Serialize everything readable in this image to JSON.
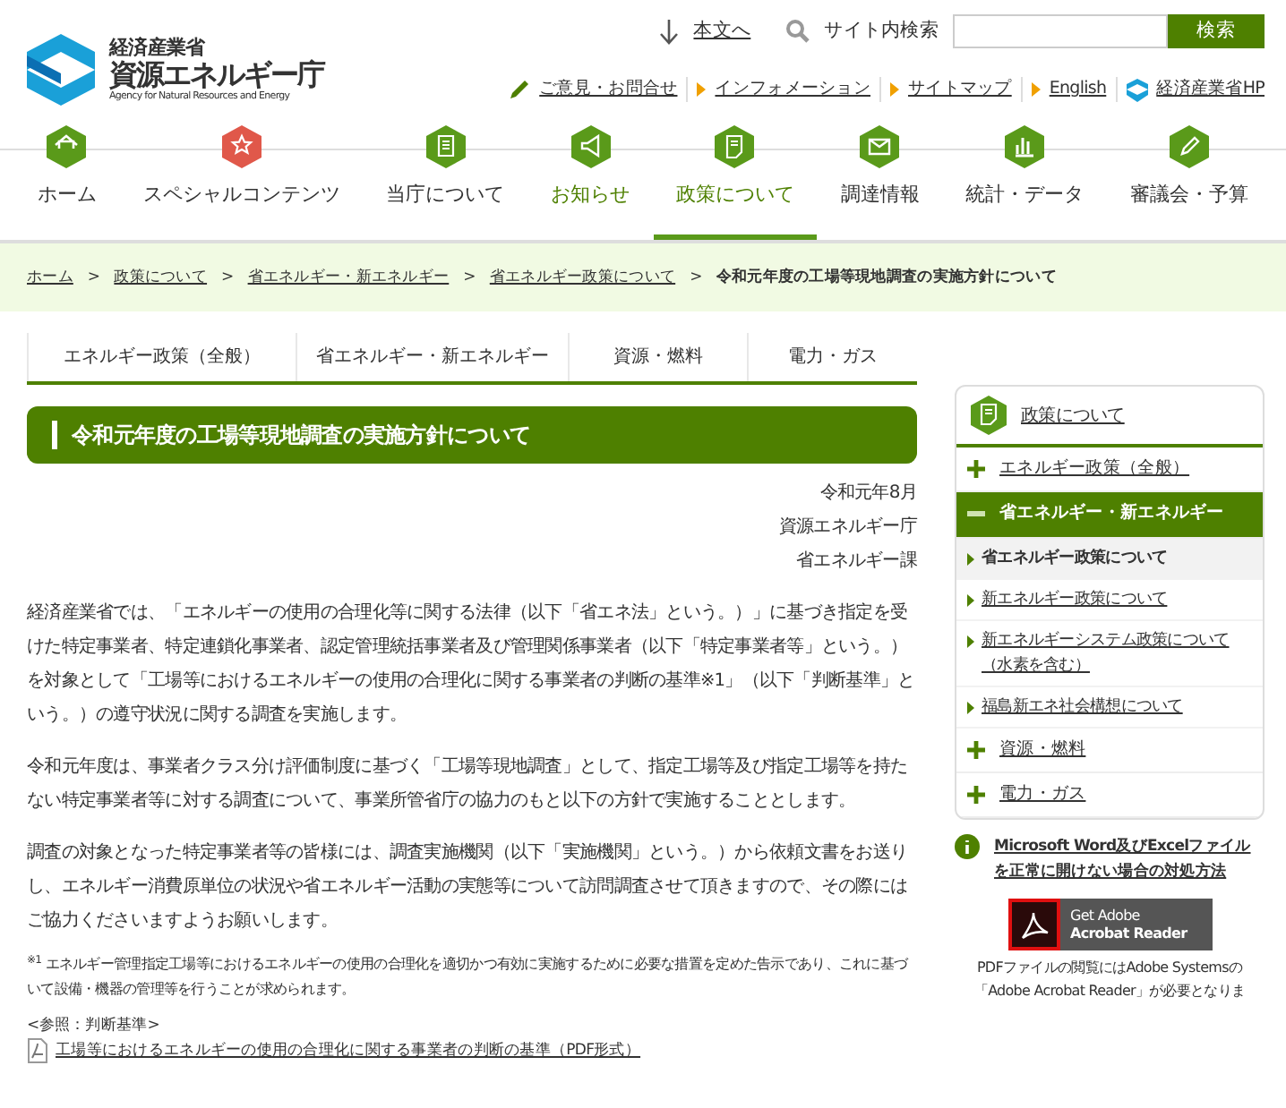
{
  "header": {
    "org_small": "経済産業省",
    "org_name": "資源エネルギー庁",
    "org_english": "Agency for Natural Resources and Energy",
    "skip_link": "本文へ",
    "search": {
      "label": "サイト内検索",
      "button": "検索"
    },
    "utility_links": [
      {
        "kind": "pencil",
        "label": "ご意見・お問合せ"
      },
      {
        "kind": "triangle",
        "label": "インフォメーション"
      },
      {
        "kind": "triangle",
        "label": "サイトマップ"
      },
      {
        "kind": "triangle",
        "label": "English"
      },
      {
        "kind": "logo",
        "label": "経済産業省HP"
      }
    ]
  },
  "main_nav": [
    {
      "label": "ホーム",
      "color": "#5a9a1a",
      "selected": false,
      "highlighted": false
    },
    {
      "label": "スペシャルコンテンツ",
      "color": "#e0584a",
      "selected": false,
      "highlighted": false
    },
    {
      "label": "当庁について",
      "color": "#5a9a1a",
      "selected": false,
      "highlighted": false
    },
    {
      "label": "お知らせ",
      "color": "#5a9a1a",
      "selected": false,
      "highlighted": true
    },
    {
      "label": "政策について",
      "color": "#5a9a1a",
      "selected": true,
      "highlighted": true
    },
    {
      "label": "調達情報",
      "color": "#5a9a1a",
      "selected": false,
      "highlighted": false
    },
    {
      "label": "統計・データ",
      "color": "#5a9a1a",
      "selected": false,
      "highlighted": false
    },
    {
      "label": "審議会・予算",
      "color": "#5a9a1a",
      "selected": false,
      "highlighted": false
    }
  ],
  "breadcrumb_separator": ">",
  "breadcrumb": [
    "ホーム",
    "政策について",
    "省エネルギー・新エネルギー",
    "省エネルギー政策について",
    "令和元年度の工場等現地調査の実施方針について"
  ],
  "sub_tabs": [
    "エネルギー政策（全般）",
    "省エネルギー・新エネルギー",
    "資源・燃料",
    "電力・ガス"
  ],
  "article": {
    "title": "令和元年度の工場等現地調査の実施方針について",
    "meta": [
      "令和元年8月",
      "資源エネルギー庁",
      "省エネルギー課"
    ],
    "paragraphs": [
      "経済産業省では、「エネルギーの使用の合理化等に関する法律（以下「省エネ法」という。）」に基づき指定を受けた特定事業者、特定連鎖化事業者、認定管理統括事業者及び管理関係事業者（以下「特定事業者等」という。）を対象として「工場等におけるエネルギーの使用の合理化に関する事業者の判断の基準※1」（以下「判断基準」という。）の遵守状況に関する調査を実施します。",
      "令和元年度は、事業者クラス分け評価制度に基づく「工場等現地調査」として、指定工場等及び指定工場等を持たない特定事業者等に対する調査について、事業所管省庁の協力のもと以下の方針で実施することとします。",
      "調査の対象となった特定事業者等の皆様には、調査実施機関（以下「実施機関」という。）から依頼文書をお送りし、エネルギー消費原単位の状況や省エネルギー活動の実態等について訪問調査させて頂きますので、その際にはご協力くださいますようお願いします。"
    ],
    "footnote": "$^{※1}$ エネルギー管理指定工場等におけるエネルギーの使用の合理化を適切かつ有効に実施するために必要な措置を定めた告示であり、これに基づいて設備・機器の管理等を行うことが求められます。",
    "reference_label": "<参照：判断基準>",
    "reference_link": "工場等におけるエネルギーの使用の合理化に関する事業者の判断の基準（PDF形式）"
  },
  "sidebar": {
    "heading": "政策について",
    "items": [
      {
        "label": "エネルギー政策（全般）",
        "expanded": false
      },
      {
        "label": "省エネルギー・新エネルギー",
        "expanded": true,
        "children": [
          {
            "label": "省エネルギー政策について",
            "selected": true
          },
          {
            "label": "新エネルギー政策について",
            "selected": false
          },
          {
            "label": "新エネルギーシステム政策について（水素を含む）",
            "selected": false
          },
          {
            "label": "福島新エネ社会構想について",
            "selected": false
          }
        ]
      },
      {
        "label": "資源・燃料",
        "expanded": false
      },
      {
        "label": "電力・ガス",
        "expanded": false
      }
    ],
    "office_help_link": "Microsoft Word及びExcelファイルを正常に開けない場合の対処方法",
    "acrobat_badge": {
      "line_1": "Get Adobe",
      "line_2": "Acrobat Reader"
    },
    "pdf_note": "PDFファイルの閲覧にはAdobe Systemsの「Adobe Acrobat Reader」が必要となりま"
  }
}
